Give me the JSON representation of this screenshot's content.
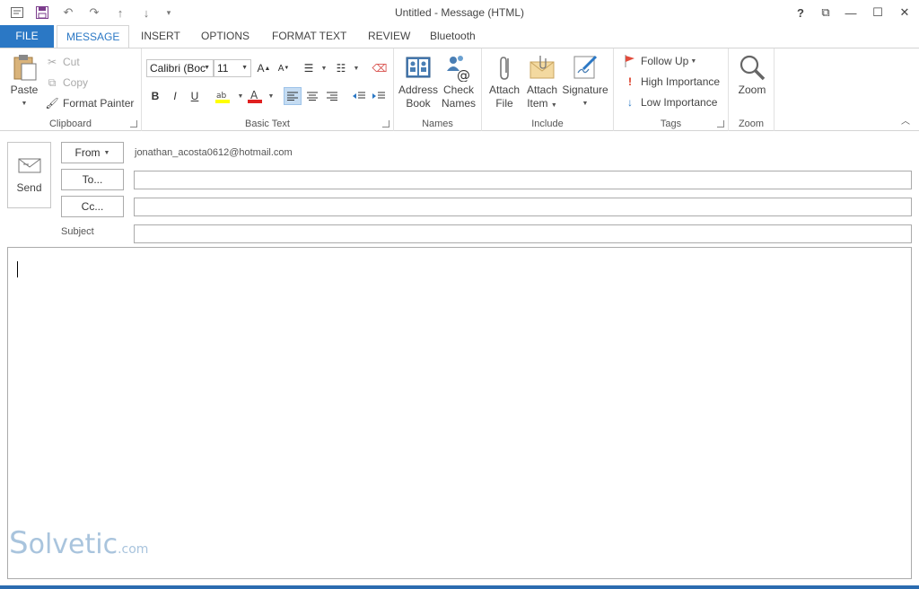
{
  "window": {
    "title": "Untitled - Message (HTML)",
    "help": "?",
    "restore": "⧉",
    "minimize": "—",
    "maximize": "☐",
    "close": "✕"
  },
  "tabs": [
    "FILE",
    "MESSAGE",
    "INSERT",
    "OPTIONS",
    "FORMAT TEXT",
    "REVIEW",
    "Bluetooth"
  ],
  "ribbon": {
    "clipboard": {
      "label": "Clipboard",
      "paste": "Paste",
      "cut": "Cut",
      "copy": "Copy",
      "format_painter": "Format Painter"
    },
    "basic_text": {
      "label": "Basic Text",
      "font": "Calibri (Boc",
      "size": "11",
      "bold": "B",
      "italic": "I",
      "underline": "U"
    },
    "names": {
      "label": "Names",
      "address_book_1": "Address",
      "address_book_2": "Book",
      "check_names_1": "Check",
      "check_names_2": "Names"
    },
    "include": {
      "label": "Include",
      "attach_file_1": "Attach",
      "attach_file_2": "File",
      "attach_item_1": "Attach",
      "attach_item_2": "Item",
      "signature": "Signature"
    },
    "tags": {
      "label": "Tags",
      "follow_up": "Follow Up",
      "high_importance": "High Importance",
      "low_importance": "Low Importance"
    },
    "zoom": {
      "label": "Zoom",
      "zoom": "Zoom"
    }
  },
  "compose": {
    "send": "Send",
    "from_label": "From",
    "from_value": "jonathan_acosta0612@hotmail.com",
    "to_label": "To...",
    "cc_label": "Cc...",
    "subject_label": "Subject",
    "to_value": "",
    "cc_value": "",
    "subject_value": ""
  },
  "watermark": {
    "text": "olvetic",
    "suffix": ".com"
  },
  "colors": {
    "accent": "#2b78c5",
    "selected_bg": "#c5dcf2"
  }
}
